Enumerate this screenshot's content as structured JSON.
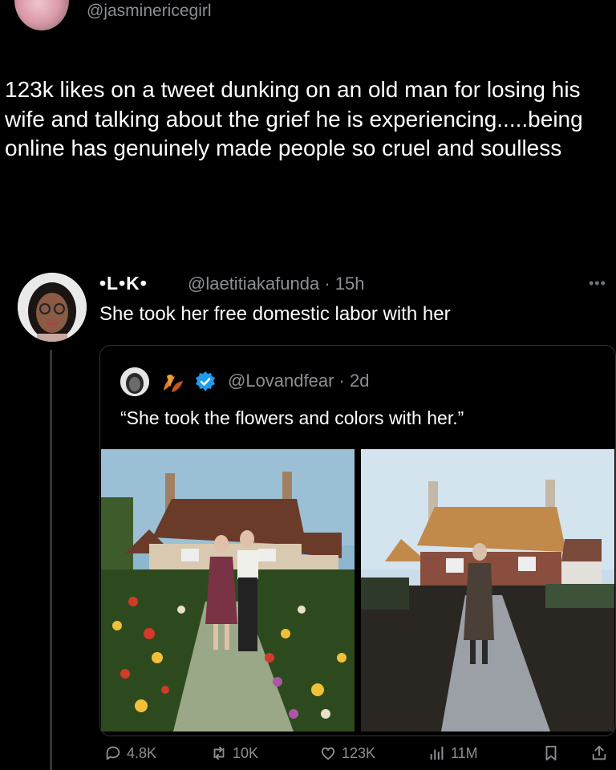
{
  "top_post": {
    "handle": "@jasminericegirl",
    "text": "123k likes on a tweet dunking on an old man for losing his wife and talking about the grief he is experiencing.....being online has genuinely made people so cruel and soulless"
  },
  "reply": {
    "display_name": "•L•K•",
    "meta": "@laetitiakafunda · 15h",
    "text": "She took her free domestic labor with her",
    "more": "•••"
  },
  "quote": {
    "handle_meta": "@Lovandfear · 2d",
    "text": "“She took the flowers and colors with her.”"
  },
  "actions": {
    "replies": "4.8K",
    "reposts": "10K",
    "likes": "123K",
    "views": "11M"
  },
  "colors": {
    "background": "#000000",
    "muted": "#8b8f94",
    "verified": "#1d9bf0"
  }
}
